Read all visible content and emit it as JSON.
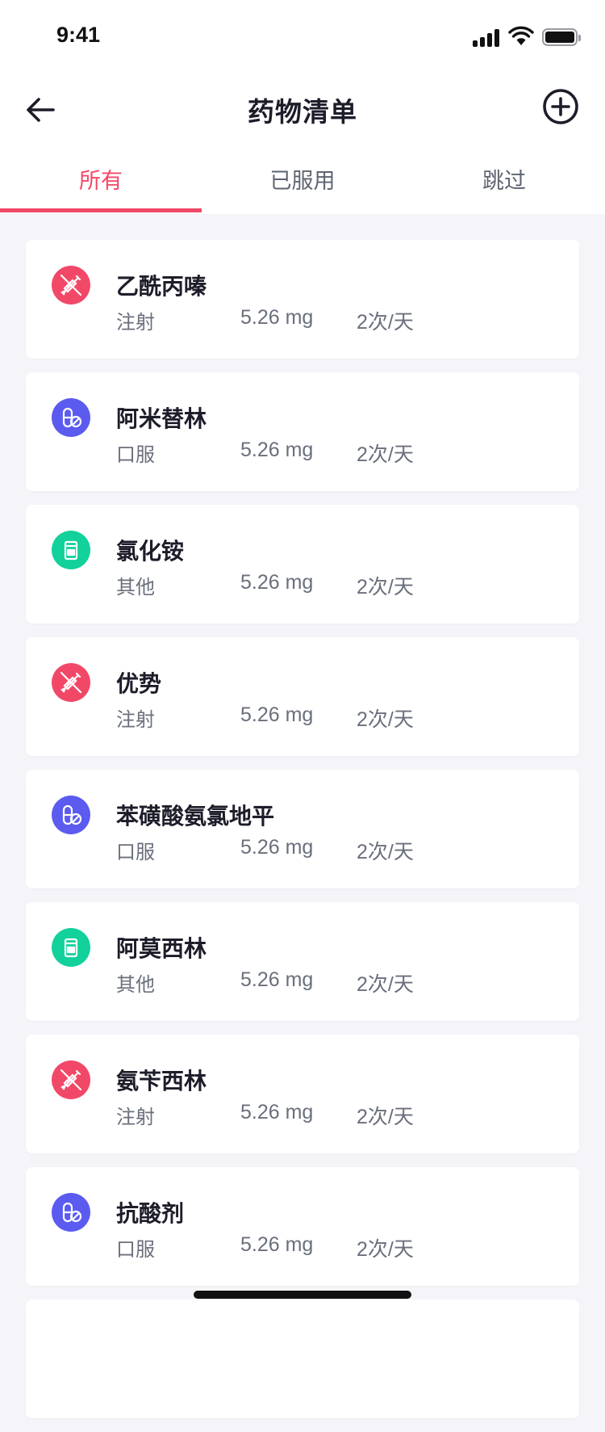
{
  "status_bar": {
    "time": "9:41"
  },
  "nav": {
    "title": "药物清单",
    "back_icon": "arrow-left-icon",
    "add_icon": "plus-circle-icon"
  },
  "tabs": [
    {
      "label": "所有",
      "active": true
    },
    {
      "label": "已服用",
      "active": false
    },
    {
      "label": "跳过",
      "active": false
    }
  ],
  "colors": {
    "accent": "#f24868",
    "injection": "#f24868",
    "oral": "#5b5bf0",
    "other": "#12d19a"
  },
  "medications": [
    {
      "name": "乙酰丙嗪",
      "route": "注射",
      "dose": "5.26 mg",
      "frequency": "2次/天",
      "icon": "syringe-icon"
    },
    {
      "name": "阿米替林",
      "route": "口服",
      "dose": "5.26 mg",
      "frequency": "2次/天",
      "icon": "pill-icon"
    },
    {
      "name": "氯化铵",
      "route": "其他",
      "dose": "5.26 mg",
      "frequency": "2次/天",
      "icon": "medicine-bottle-icon"
    },
    {
      "name": "优势",
      "route": "注射",
      "dose": "5.26 mg",
      "frequency": "2次/天",
      "icon": "syringe-icon"
    },
    {
      "name": "苯磺酸氨氯地平",
      "route": "口服",
      "dose": "5.26 mg",
      "frequency": "2次/天",
      "icon": "pill-icon"
    },
    {
      "name": "阿莫西林",
      "route": "其他",
      "dose": "5.26 mg",
      "frequency": "2次/天",
      "icon": "medicine-bottle-icon"
    },
    {
      "name": "氨苄西林",
      "route": "注射",
      "dose": "5.26 mg",
      "frequency": "2次/天",
      "icon": "syringe-icon"
    },
    {
      "name": "抗酸剂",
      "route": "口服",
      "dose": "5.26 mg",
      "frequency": "2次/天",
      "icon": "pill-icon"
    }
  ]
}
